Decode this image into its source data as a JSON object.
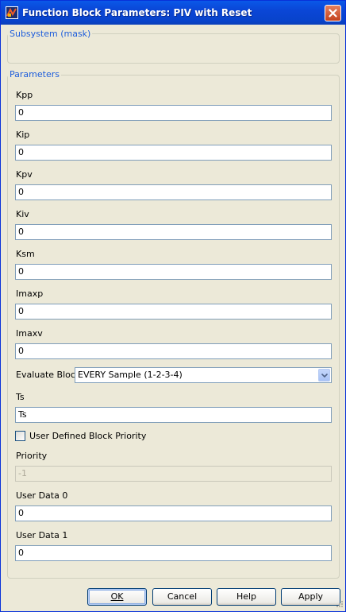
{
  "window": {
    "title": "Function Block Parameters: PIV with Reset"
  },
  "groups": {
    "subsystem": "Subsystem (mask)",
    "parameters": "Parameters"
  },
  "params": {
    "kpp": {
      "label": "Kpp",
      "value": "0"
    },
    "kip": {
      "label": "Kip",
      "value": "0"
    },
    "kpv": {
      "label": "Kpv",
      "value": "0"
    },
    "kiv": {
      "label": "Kiv",
      "value": "0"
    },
    "ksm": {
      "label": "Ksm",
      "value": "0"
    },
    "imaxp": {
      "label": "Imaxp",
      "value": "0"
    },
    "imaxv": {
      "label": "Imaxv",
      "value": "0"
    },
    "evaluate": {
      "label": "Evaluate Block",
      "value": "EVERY Sample (1-2-3-4)"
    },
    "ts": {
      "label": "Ts",
      "value": "Ts"
    },
    "user_priority": {
      "label": "User Defined Block Priority",
      "checked": false
    },
    "priority": {
      "label": "Priority",
      "value": "-1"
    },
    "user_data0": {
      "label": "User Data 0",
      "value": "0"
    },
    "user_data1": {
      "label": "User Data 1",
      "value": "0"
    }
  },
  "buttons": {
    "ok": "OK",
    "cancel": "Cancel",
    "help": "Help",
    "apply": "Apply"
  },
  "icons": {
    "app": "simulink-icon",
    "close": "close-icon",
    "dropdown": "chevron-down-icon",
    "grip": "resize-grip-icon"
  },
  "colors": {
    "title_bar": "#0A46D6",
    "close_button": "#C4411C",
    "dialog_bg": "#ECE9D8",
    "group_title": "#1D5DDB"
  }
}
